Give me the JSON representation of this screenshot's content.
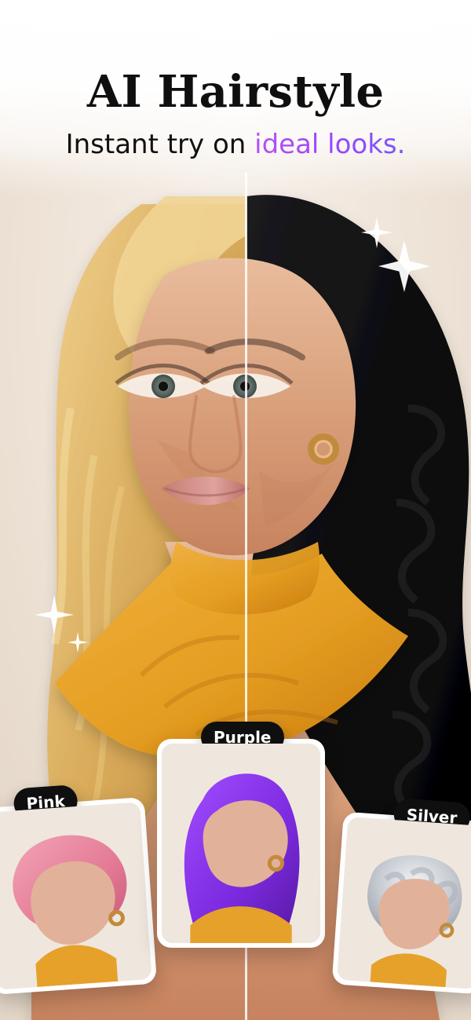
{
  "header": {
    "title": "AI Hairstyle",
    "subtitle_prefix": "Instant try on ",
    "subtitle_highlight": "ideal looks."
  },
  "cards": [
    {
      "label": "Pink"
    },
    {
      "label": "Purple"
    },
    {
      "label": "Silver"
    }
  ],
  "colors": {
    "highlight_gradient_start": "#b452f2",
    "highlight_gradient_end": "#7a55ff",
    "top_gradient": "#ffffff",
    "pill_bg": "#0f0f0f",
    "card_border": "#ffffff",
    "top_outfit": "#e6a12a"
  },
  "icons": {
    "sparkle_top_right_large": "sparkle-icon",
    "sparkle_top_right_small": "sparkle-icon",
    "sparkle_left_large": "sparkle-icon",
    "sparkle_left_small": "sparkle-icon"
  }
}
